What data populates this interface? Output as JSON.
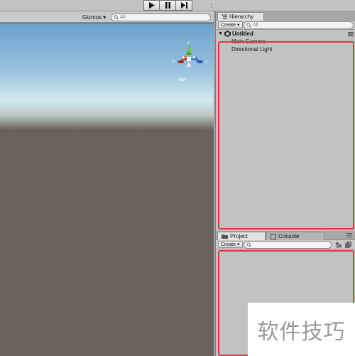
{
  "toolbar": {
    "play_icon": "play-icon",
    "pause_icon": "pause-icon",
    "step_icon": "step-icon"
  },
  "scene": {
    "gizmos_label": "Gizmos",
    "search_placeholder": "All",
    "axis_y": "y",
    "axis_x": "x",
    "axis_z": "z",
    "colors": {
      "sky_top": "#6ba1cc",
      "horizon": "#d2e9ee",
      "ground": "#6a615c"
    }
  },
  "hierarchy": {
    "tab_label": "Hierarchy",
    "create_label": "Create",
    "search_placeholder": "All",
    "scene_name": "Untitled",
    "items": [
      "Main Camera",
      "Directional Light"
    ]
  },
  "project": {
    "tabs": [
      "Project",
      "Console"
    ],
    "create_label": "Create"
  },
  "watermark": {
    "text": "软件技巧"
  },
  "highlight_color": "#e5343a"
}
